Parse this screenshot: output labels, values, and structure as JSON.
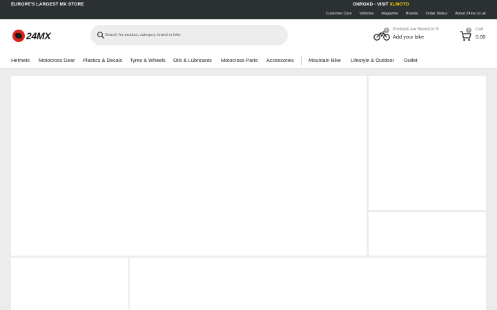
{
  "topbar": {
    "promo_left": "EUROPE'S LARGEST MX STORE",
    "promo_right_prefix": "ONROAD - VISIT ",
    "promo_right_highlight": "XLMOTO",
    "links": [
      "Customer Care",
      "Vehicles",
      "Magazine",
      "Brands",
      "Order Status",
      "About 24mx.co.uk"
    ]
  },
  "header": {
    "logo_text": "24MX",
    "search_placeholder": "Search for product, category, brand or bike",
    "bike_badge": "0",
    "bike_line1": "Products are filtered to fit",
    "bike_line2": "Add your bike",
    "cart_badge": "0",
    "cart_label": "Cart",
    "cart_amount": "0.00"
  },
  "nav": {
    "items": [
      "Helmets",
      "Motocross Gear",
      "Plastics & Decals",
      "Tyres & Wheels",
      "Oils & Lubricants",
      "Motocross Parts",
      "Accessories",
      "Mountain Bike",
      "Lifestyle & Outdoor",
      "Outlet"
    ]
  },
  "colors": {
    "topbar_bg": "#2b3032",
    "highlight": "#f5d300",
    "logo_red": "#d8261c",
    "page_bg": "#ececec"
  },
  "icons": {
    "search": "search-icon",
    "bike": "motorbike-icon",
    "cart": "cart-icon"
  }
}
